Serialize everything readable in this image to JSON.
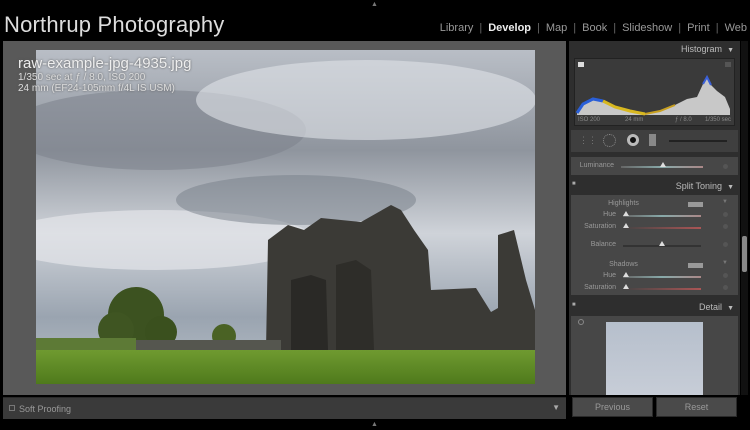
{
  "app": {
    "brand": "Northrup Photography"
  },
  "modules": [
    {
      "label": "Library"
    },
    {
      "label": "Develop",
      "active": true
    },
    {
      "label": "Map"
    },
    {
      "label": "Book"
    },
    {
      "label": "Slideshow"
    },
    {
      "label": "Print"
    },
    {
      "label": "Web"
    }
  ],
  "photo": {
    "filename": "raw-example-jpg-4935.jpg",
    "exposure": "1/350 sec at ƒ / 8.0, ISO 200",
    "lens": "24 mm (EF24-105mm f/4L IS USM)"
  },
  "histogram": {
    "title": "Histogram",
    "iso": "ISO 200",
    "focal": "24 mm",
    "aperture": "ƒ / 8.0",
    "shutter": "1/350 sec"
  },
  "luminance": {
    "label": "Luminance",
    "value": 0.5
  },
  "split_toning": {
    "title": "Split Toning",
    "highlights": "Highlights",
    "shadows": "Shadows",
    "hue": "Hue",
    "saturation": "Saturation",
    "balance": "Balance",
    "values": {
      "hl_hue": 0,
      "hl_sat": 0,
      "balance": 0.5,
      "sh_hue": 0,
      "sh_sat": 0
    }
  },
  "detail": {
    "title": "Detail"
  },
  "toolbar": {
    "soft_proofing": "Soft Proofing"
  },
  "buttons": {
    "previous": "Previous",
    "reset": "Reset"
  },
  "colors": {
    "grass": "#5f8a2a",
    "sky": "#c8cdd4",
    "ruin": "#3b3a36"
  }
}
